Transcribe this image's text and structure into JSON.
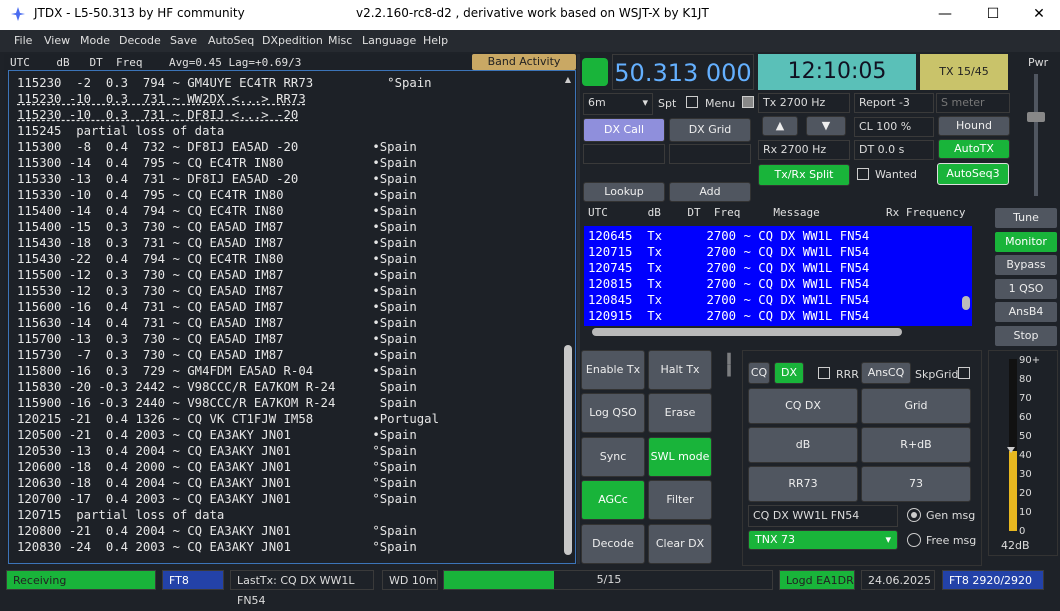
{
  "title": {
    "app": "JTDX - L5-50.313  by HF community",
    "center": "v2.2.160-rc8-d2 , derivative work based on WSJT-X by K1JT"
  },
  "menu": [
    "File",
    "View",
    "Mode",
    "Decode",
    "Save",
    "AutoSeq",
    "DXpedition",
    "Misc",
    "Language",
    "Help"
  ],
  "left": {
    "header": "UTC    dB   DT  Freq    Avg=0.45 Lag=+0.69/3",
    "band_button": "Band Activity",
    "lines": [
      "115230  -2  0.3  794 ~ GM4UYE EC4TR RR73          °Spain",
      "115230 -10  0.3  731 ~ WW2DX <...> RR73",
      "115230 -10  0.3  731 ~ DF8IJ <...> -20",
      "115245  partial loss of data",
      "115300  -8  0.4  732 ~ DF8IJ EA5AD -20          •Spain",
      "115300 -14  0.4  795 ~ CQ EC4TR IN80            •Spain",
      "115330 -13  0.4  731 ~ DF8IJ EA5AD -20          •Spain",
      "115330 -10  0.4  795 ~ CQ EC4TR IN80            •Spain",
      "115400 -14  0.4  794 ~ CQ EC4TR IN80            •Spain",
      "115400 -15  0.3  730 ~ CQ EA5AD IM87            •Spain",
      "115430 -18  0.3  731 ~ CQ EA5AD IM87            •Spain",
      "115430 -22  0.4  794 ~ CQ EC4TR IN80            •Spain",
      "115500 -12  0.3  730 ~ CQ EA5AD IM87            •Spain",
      "115530 -12  0.3  730 ~ CQ EA5AD IM87            •Spain",
      "115600 -16  0.4  731 ~ CQ EA5AD IM87            •Spain",
      "115630 -14  0.4  731 ~ CQ EA5AD IM87            •Spain",
      "115700 -13  0.3  730 ~ CQ EA5AD IM87            •Spain",
      "115730  -7  0.3  730 ~ CQ EA5AD IM87            •Spain",
      "115800 -16  0.3  729 ~ GM4FDM EA5AD R-04        •Spain",
      "115830 -20 -0.3 2442 ~ V98CCC/R EA7KOM R-24      Spain",
      "115900 -16 -0.3 2440 ~ V98CCC/R EA7KOM R-24      Spain",
      "120215 -21  0.4 1326 ~ CQ VK CT1FJW IM58        •Portugal",
      "120500 -21  0.4 2003 ~ CQ EA3AKY JN01           •Spain",
      "120530 -13  0.4 2004 ~ CQ EA3AKY JN01           °Spain",
      "120600 -18  0.4 2000 ~ CQ EA3AKY JN01           °Spain",
      "120630 -18  0.4 2004 ~ CQ EA3AKY JN01           °Spain",
      "120700 -17  0.4 2003 ~ CQ EA3AKY JN01           °Spain",
      "120715  partial loss of data",
      "120800 -21  0.4 2004 ~ CQ EA3AKY JN01           °Spain",
      "120830 -24  0.4 2003 ~ CQ EA3AKY JN01           °Spain"
    ]
  },
  "top": {
    "frequency": "50.313 000",
    "clock": "12:10:05",
    "tx_period": "TX 15/45",
    "band": "6m",
    "spt": "Spt",
    "menu_label": "Menu",
    "tx_hz": "Tx  2700  Hz",
    "rx_hz": "Rx  2700  Hz",
    "report": "Report -3",
    "smeter": "S meter",
    "cl": "CL  100 %",
    "dt": "DT  0.0 s",
    "hound": "Hound",
    "autotx": "AutoTX",
    "txrx_split": "Tx/Rx Split",
    "wanted": "Wanted",
    "autoseq": "AutoSeq3",
    "dx_call": "DX Call",
    "dx_grid": "DX Grid",
    "lookup": "Lookup",
    "add": "Add",
    "pwr": "Pwr"
  },
  "rx": {
    "header": "UTC      dB    DT  Freq     Message          Rx Frequency",
    "lines": [
      "120645  Tx      2700 ~ CQ DX WW1L FN54",
      "120715  Tx      2700 ~ CQ DX WW1L FN54",
      "120745  Tx      2700 ~ CQ DX WW1L FN54",
      "120815  Tx      2700 ~ CQ DX WW1L FN54",
      "120845  Tx      2700 ~ CQ DX WW1L FN54",
      "120915  Tx      2700 ~ CQ DX WW1L FN54"
    ]
  },
  "side": [
    "Tune",
    "Monitor",
    "Bypass",
    "1 QSO",
    "AnsB4",
    "Stop"
  ],
  "controls": {
    "enable_tx": "Enable Tx",
    "halt_tx": "Halt Tx",
    "log_qso": "Log QSO",
    "erase": "Erase",
    "sync": "Sync",
    "swl_mode": "SWL mode",
    "agcc": "AGCc",
    "filter": "Filter",
    "decode": "Decode",
    "clear_dx": "Clear DX"
  },
  "msgpanel": {
    "cq": "CQ",
    "dx": "DX",
    "rrr": "RRR",
    "anscq": "AnsCQ",
    "skpgrid": "SkpGrid",
    "cqdx": "CQ DX",
    "grid": "Grid",
    "db": "dB",
    "rdb": "R+dB",
    "rr73": "RR73",
    "n73": "73",
    "gen_field": "CQ DX WW1L FN54",
    "tnx": "TNX 73",
    "gen_msg": "Gen msg",
    "free_msg": "Free msg"
  },
  "meter": {
    "ticks": [
      "90+",
      "80",
      "70",
      "60",
      "50",
      "40",
      "30",
      "20",
      "10",
      "0"
    ],
    "reading": "42dB",
    "level_db": 42
  },
  "status": {
    "receiving": "Receiving",
    "mode": "FT8",
    "lasttx": "LastTx: CQ DX WW1L FN54",
    "wd": "WD 10m",
    "progress": "5/15",
    "progress_fraction": 0.3333,
    "logd": "Logd EA1DR",
    "date": "24.06.2025",
    "ft8count": "FT8  2920/2920"
  },
  "colors": {
    "green": "#19b43a",
    "blue": "#0000fe",
    "lavender": "#8f8fdc",
    "teal": "#5ac0b8",
    "gold": "#c9a864"
  }
}
